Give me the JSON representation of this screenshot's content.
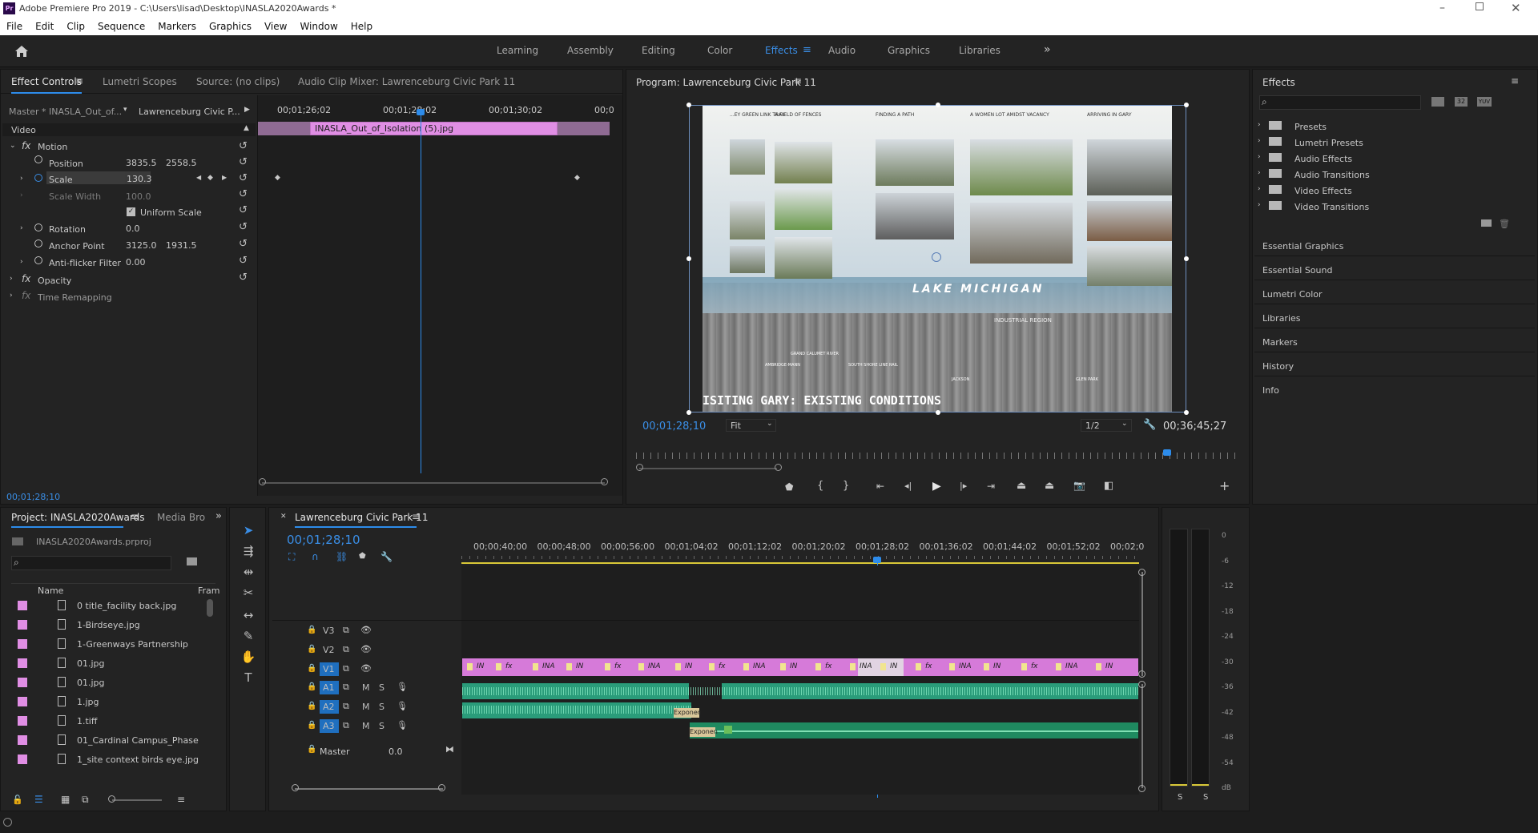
{
  "app": {
    "title": "Adobe Premiere Pro 2019 - C:\\Users\\lisad\\Desktop\\INASLA2020Awards *",
    "logo": "Pr"
  },
  "menu": [
    "File",
    "Edit",
    "Clip",
    "Sequence",
    "Markers",
    "Graphics",
    "View",
    "Window",
    "Help"
  ],
  "workspaces": [
    "Learning",
    "Assembly",
    "Editing",
    "Color",
    "Effects",
    "Audio",
    "Graphics",
    "Libraries"
  ],
  "effect_controls": {
    "tabs": [
      "Effect Controls",
      "Lumetri Scopes",
      "Source: (no clips)",
      "Audio Clip Mixer: Lawrenceburg Civic Park 11"
    ],
    "master": "Master * INASLA_Out_of...",
    "sequence": "Lawrenceburg Civic P...",
    "section": "Video",
    "motion": "Motion",
    "position_label": "Position",
    "position_x": "3835.5",
    "position_y": "2558.5",
    "scale_label": "Scale",
    "scale_value": "130.3",
    "scale_width_label": "Scale Width",
    "scale_width_value": "100.0",
    "uniform_scale": "Uniform Scale",
    "rotation_label": "Rotation",
    "rotation_value": "0.0",
    "anchor_label": "Anchor Point",
    "anchor_x": "3125.0",
    "anchor_y": "1931.5",
    "antiflicker_label": "Anti-flicker Filter",
    "antiflicker_value": "0.00",
    "opacity": "Opacity",
    "time_remap": "Time Remapping",
    "timecode": "00;01;28;10",
    "ruler": [
      "00;01;26;02",
      "00;01;28;02",
      "00;01;30;02",
      "00;0"
    ],
    "clip_name": "INASLA_Out_of_Isolation (5).jpg"
  },
  "program": {
    "title": "Program: Lawrenceburg Civic Park 11",
    "timecode": "00;01;28;10",
    "fit": "Fit",
    "resolution": "1/2",
    "duration": "00;36;45;27",
    "image": {
      "headings": [
        "...EY GREEN LINK TRAIL",
        "A FIELD OF FENCES",
        "FINDING A PATH",
        "A WOMEN LOT AMIDST VACANCY",
        "ARRIVING IN GARY"
      ],
      "lake": "LAKE  MICHIGAN",
      "region": "INDUSTRIAL REGION",
      "place_labels": [
        "AMBRIDGE-MANN",
        "GRAND CALUMET RIVER",
        "SOUTH SHORE LINE RAIL",
        "JACKSON",
        "GLEN PARK"
      ],
      "bottom": "ISITING GARY: EXISTING CONDITIONS"
    }
  },
  "effects_panel": {
    "title": "Effects",
    "tree": [
      "Presets",
      "Lumetri Presets",
      "Audio Effects",
      "Audio Transitions",
      "Video Effects",
      "Video Transitions"
    ],
    "sections": [
      "Essential Graphics",
      "Essential Sound",
      "Lumetri Color",
      "Libraries",
      "Markers",
      "History",
      "Info"
    ],
    "badges": [
      "32",
      "YUV"
    ]
  },
  "project": {
    "tabs": [
      "Project: INASLA2020Awards",
      "Media Bro"
    ],
    "file": "INASLA2020Awards.prproj",
    "col_name": "Name",
    "col_fr": "Fram",
    "items": [
      "0 title_facility back.jpg",
      "1-Birdseye.jpg",
      "1-Greenways Partnership",
      "01.jpg",
      "01.jpg",
      "1.jpg",
      "1.tiff",
      "01_Cardinal Campus_Phase",
      "1_site context birds eye.jpg"
    ]
  },
  "timeline": {
    "title": "Lawrenceburg Civic Park 11",
    "timecode": "00;01;28;10",
    "ruler": [
      "00;00;40;00",
      "00;00;48;00",
      "00;00;56;00",
      "00;01;04;02",
      "00;01;12;02",
      "00;01;20;02",
      "00;01;28;02",
      "00;01;36;02",
      "00;01;44;02",
      "00;01;52;02",
      "00;02;0"
    ],
    "video_tracks": [
      "V3",
      "V2",
      "V1"
    ],
    "audio_tracks": [
      "A1",
      "A2",
      "A3"
    ],
    "master_label": "Master",
    "master_value": "0.0",
    "m": "M",
    "s": "S",
    "clip_labels": [
      "fx",
      "IN",
      "INA"
    ],
    "audio_clip": "Exponen"
  },
  "meter": {
    "labels": [
      "0",
      "-6",
      "-12",
      "-18",
      "-24",
      "-30",
      "-36",
      "-42",
      "-48",
      "-54",
      "dB"
    ],
    "solo": [
      "S",
      "S"
    ]
  }
}
